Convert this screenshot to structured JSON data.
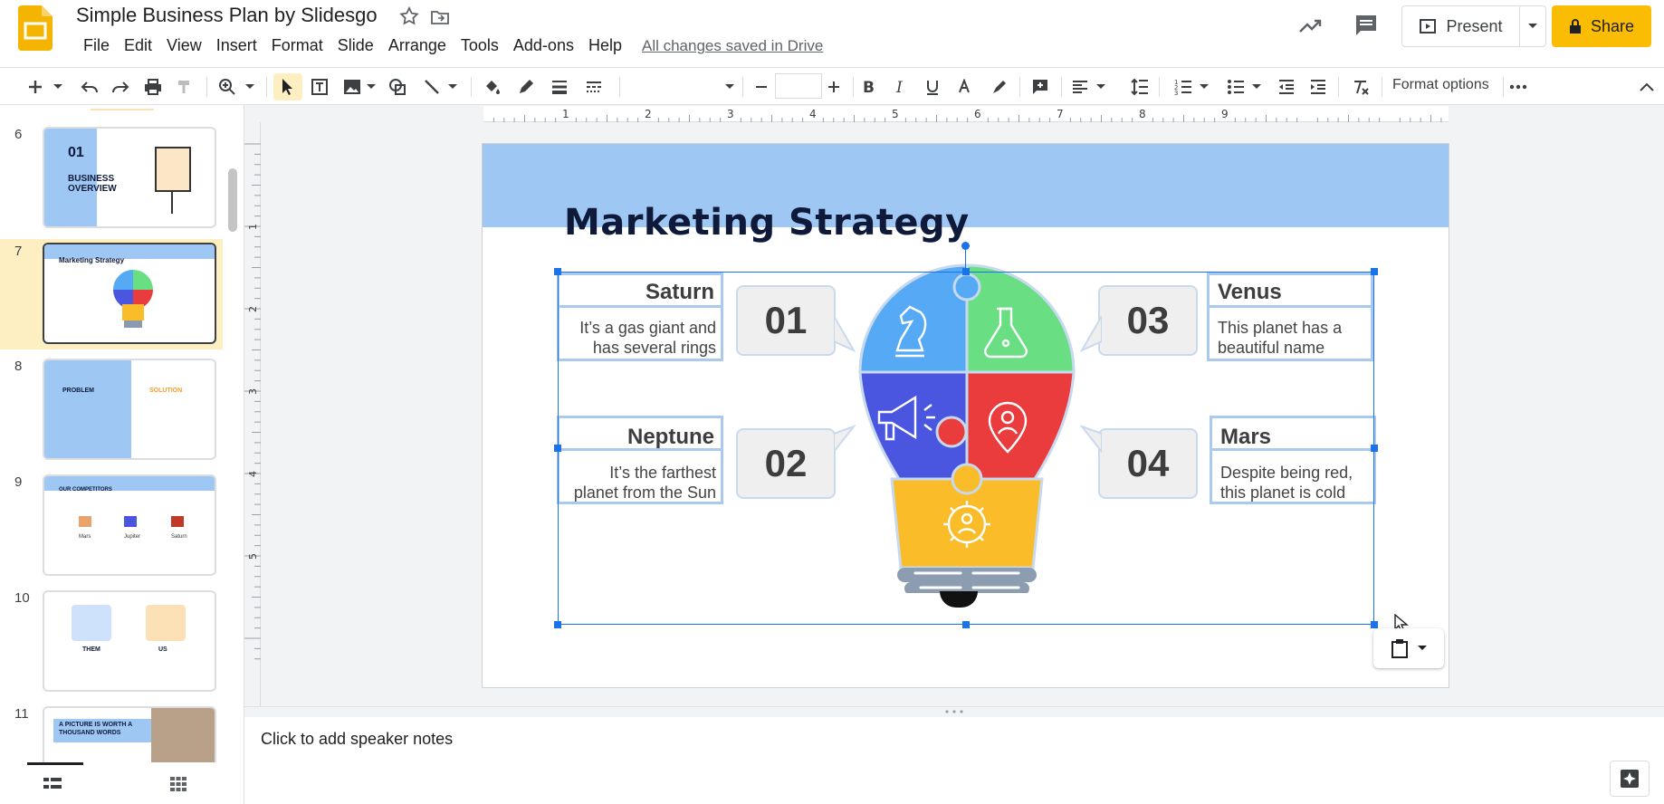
{
  "header": {
    "doc_title": "Simple Business Plan by Slidesgo",
    "menu": [
      "File",
      "Edit",
      "View",
      "Insert",
      "Format",
      "Slide",
      "Arrange",
      "Tools",
      "Add-ons",
      "Help"
    ],
    "saved_status": "All changes saved in Drive",
    "present_label": "Present",
    "share_label": "Share"
  },
  "toolbar": {
    "format_options_label": "Format options"
  },
  "filmstrip": {
    "slides": [
      {
        "number": "6",
        "title": "BUSINESS OVERVIEW",
        "tag": "01"
      },
      {
        "number": "7",
        "title": "Marketing Strategy",
        "selected": true
      },
      {
        "number": "8",
        "title": "PROBLEM",
        "subtitle": "SOLUTION"
      },
      {
        "number": "9",
        "title": "OUR COMPETITORS",
        "items": [
          "Mars",
          "Jupiter",
          "Saturn"
        ]
      },
      {
        "number": "10",
        "left": "THEM",
        "right": "US"
      },
      {
        "number": "11",
        "title": "A PICTURE IS WORTH A THOUSAND WORDS"
      }
    ]
  },
  "slide": {
    "title": "Marketing Strategy",
    "items": [
      {
        "number": "01",
        "name": "Saturn",
        "text_line1": "It’s a gas giant and",
        "text_line2": "has several rings"
      },
      {
        "number": "02",
        "name": "Neptune",
        "text_line1": "It’s the farthest",
        "text_line2": "planet from the Sun"
      },
      {
        "number": "03",
        "name": "Venus",
        "text_line1": "This planet has a",
        "text_line2": "beautiful name"
      },
      {
        "number": "04",
        "name": "Mars",
        "text_line1": "Despite being red,",
        "text_line2": "this planet is cold"
      }
    ],
    "bulb_colors": [
      "#56a9f5",
      "#69de82",
      "#4a55e0",
      "#ea3c3d",
      "#fbbc2a"
    ]
  },
  "ruler_labels": [
    "1",
    "2",
    "3",
    "4",
    "5",
    "6",
    "7",
    "8",
    "9"
  ],
  "ruler_left_labels": [
    "1",
    "2",
    "3",
    "4",
    "5"
  ],
  "notes": {
    "placeholder": "Click to add speaker notes"
  },
  "colors": {
    "accent": "#fbbc04",
    "selection": "#1a73e8",
    "slide_band": "#9fc7f4"
  }
}
